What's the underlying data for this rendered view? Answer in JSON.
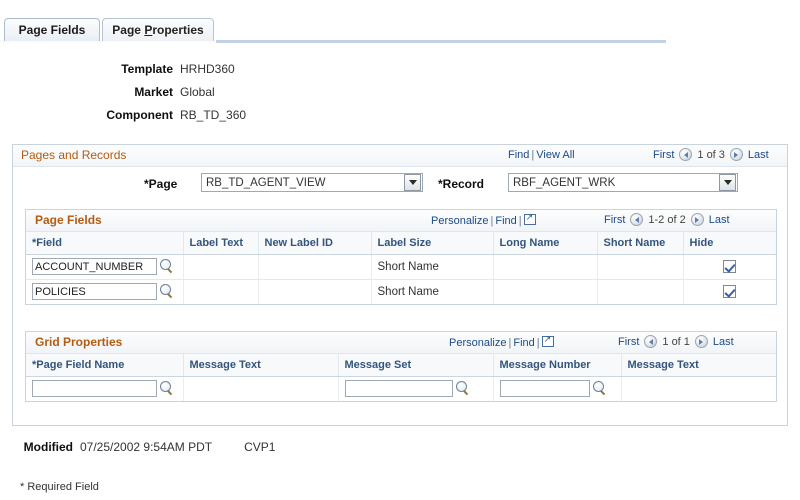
{
  "tabs": [
    {
      "label": "Page Fields",
      "active": true
    },
    {
      "label_pre": "Page ",
      "label_accesskey": "P",
      "label_post": "roperties",
      "active": false
    }
  ],
  "key_fields": [
    {
      "label": "Template",
      "value": "HRHD360"
    },
    {
      "label": "Market",
      "value": "Global"
    },
    {
      "label": "Component",
      "value": "RB_TD_360"
    }
  ],
  "pages_and_records": {
    "title": "Pages and Records",
    "find_label": "Find",
    "viewall_label": "View All",
    "separator": "|",
    "first_label": "First",
    "count_label": "1 of 3",
    "last_label": "Last",
    "page_field": {
      "label": "*Page",
      "value": "RB_TD_AGENT_VIEW"
    },
    "record_field": {
      "label": "*Record",
      "value": "RBF_AGENT_WRK"
    }
  },
  "page_fields_grid": {
    "title": "Page Fields",
    "personalize_label": "Personalize",
    "find_label": "Find",
    "separator": "|",
    "popout_icon": "new-window-icon",
    "first_label": "First",
    "count_label": "1-2 of 2",
    "last_label": "Last",
    "columns": [
      "*Field",
      "Label Text",
      "New Label ID",
      "Label Size",
      "Long Name",
      "Short Name",
      "Hide"
    ],
    "rows": [
      {
        "field": "ACCOUNT_NUMBER",
        "label_text": "",
        "new_label_id": "",
        "label_size": "Short Name",
        "long_name": "",
        "short_name": "",
        "hide": true
      },
      {
        "field": "POLICIES",
        "label_text": "",
        "new_label_id": "",
        "label_size": "Short Name",
        "long_name": "",
        "short_name": "",
        "hide": true
      }
    ]
  },
  "grid_properties": {
    "title": "Grid Properties",
    "personalize_label": "Personalize",
    "find_label": "Find",
    "separator": "|",
    "popout_icon": "new-window-icon",
    "first_label": "First",
    "count_label": "1 of 1",
    "last_label": "Last",
    "columns": [
      "*Page Field Name",
      "Message Text",
      "Message Set",
      "Message Number",
      "Message Text"
    ],
    "rows": [
      {
        "page_field_name": "",
        "message_text": "",
        "message_set": "",
        "message_number": "",
        "message_text_2": ""
      }
    ]
  },
  "footer": {
    "modified_label": "Modified",
    "modified_value": "07/25/2002  9:54AM PDT",
    "modified_user": "CVP1",
    "required_note": "* Required Field"
  },
  "colors": {
    "group_title": "#b35c12",
    "link": "#1c4a87",
    "column_header_text": "#33557d",
    "border": "#c9d3de"
  }
}
